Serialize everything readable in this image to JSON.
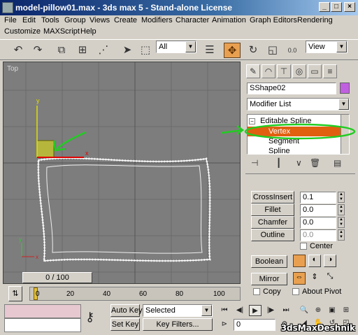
{
  "window": {
    "title": "model-pillow01.max - 3ds max 5 - Stand-alone License"
  },
  "menu": {
    "row1": [
      "File",
      "Edit",
      "Tools",
      "Group",
      "Views",
      "Create",
      "Modifiers",
      "Character",
      "Animation",
      "Graph Editors",
      "Rendering"
    ],
    "row2": [
      "Customize",
      "MAXScript",
      "Help"
    ]
  },
  "toolbar": {
    "selection_filter": "All",
    "reference_coord": "View"
  },
  "viewport": {
    "label": "Top",
    "axis_x": "x",
    "axis_y": "y"
  },
  "command_panel": {
    "object_name": "SShape02",
    "object_color": "#c060e0",
    "modifier_list": "Modifier List",
    "stack": {
      "root": "Editable Spline",
      "items": [
        "Vertex",
        "Segment",
        "Spline"
      ],
      "selected": "Vertex"
    },
    "buttons": {
      "cross_insert": "CrossInsert",
      "fillet": "Fillet",
      "chamfer": "Chamfer",
      "outline": "Outline",
      "boolean": "Boolean",
      "mirror": "Mirror"
    },
    "values": {
      "cross_insert": "0.1",
      "fillet": "0.0",
      "chamfer": "0.0",
      "outline": "0.0"
    },
    "checks": {
      "center": "Center",
      "copy": "Copy",
      "about_pivot": "About Pivot"
    }
  },
  "timeline": {
    "frame_display": "0 / 100",
    "ticks": [
      "0",
      "20",
      "40",
      "60",
      "80",
      "100"
    ]
  },
  "status": {
    "auto_key": "Auto Key",
    "set_key": "Set Key",
    "key_mode": "Selected",
    "key_filters": "Key Filters...",
    "current_frame": "0"
  },
  "watermark": "3dsMaxDeshnik",
  "colors": {
    "annotation": "#22cc22",
    "selection": "#e06010",
    "title_bar": "#0a246a"
  }
}
